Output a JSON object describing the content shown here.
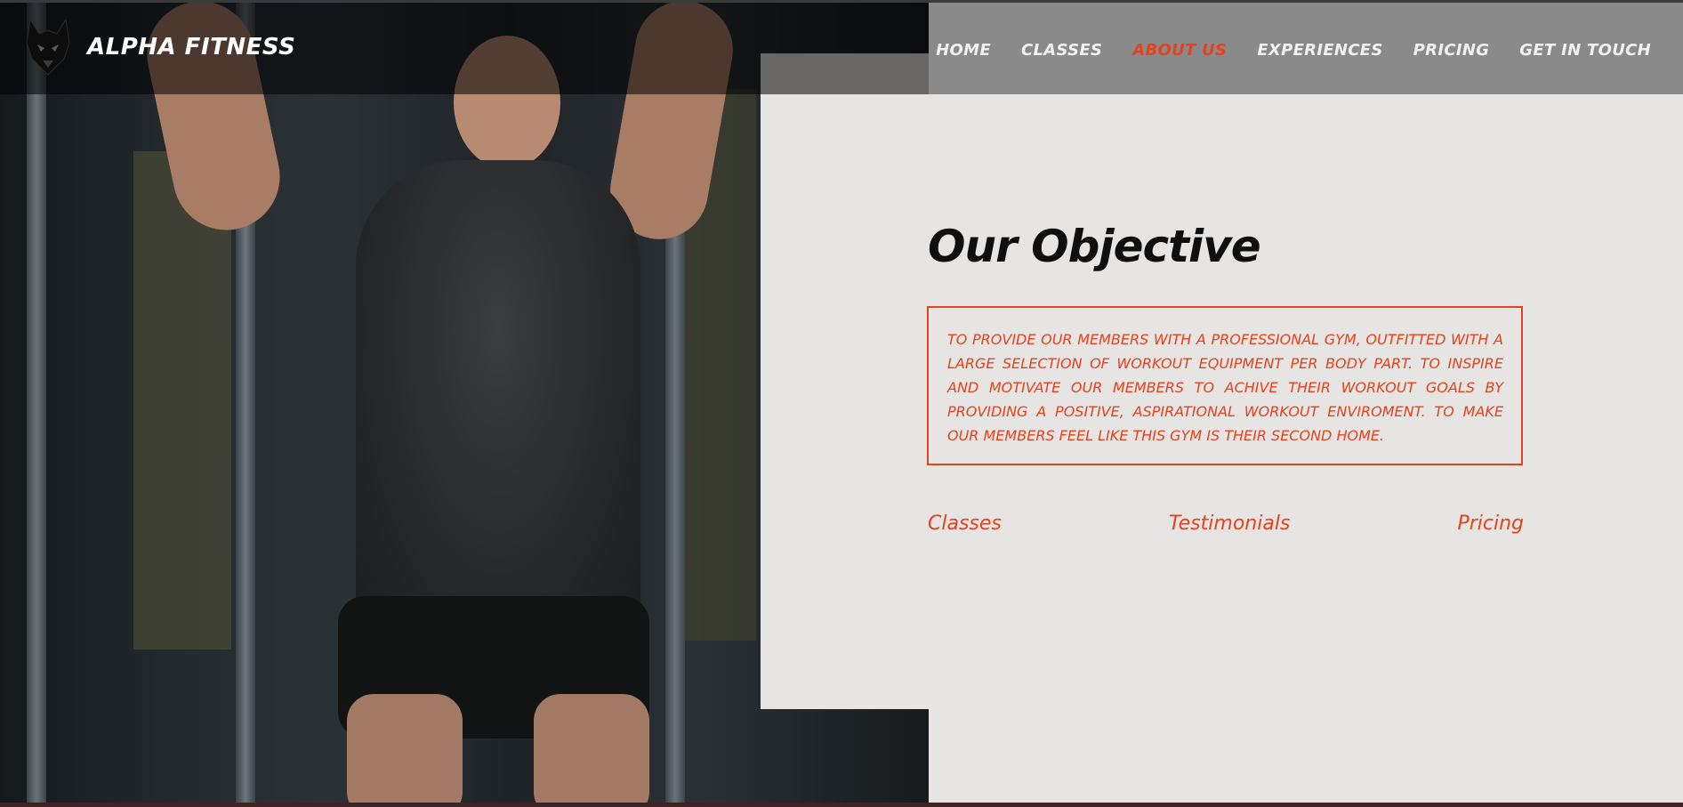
{
  "brand": {
    "name": "ALPHA FITNESS",
    "logo_icon": "wolf-icon"
  },
  "nav": {
    "items": [
      {
        "label": "HOME"
      },
      {
        "label": "CLASSES"
      },
      {
        "label": "ABOUT US",
        "active": true
      },
      {
        "label": "EXPERIENCES"
      },
      {
        "label": "PRICING"
      },
      {
        "label": "GET IN TOUCH"
      }
    ]
  },
  "objective": {
    "title": "Our Objective",
    "text": "TO PROVIDE OUR MEMBERS WITH A PROFESSIONAL GYM, OUTFITTED WITH A LARGE SELECTION OF WORKOUT EQUIPMENT PER BODY PART. TO INSPIRE AND MOTIVATE OUR MEMBERS TO ACHIVE THEIR WORKOUT GOALS BY PROVIDING A POSITIVE, ASPIRATIONAL WORKOUT ENVIROMENT. TO MAKE OUR MEMBERS FEEL LIKE THIS GYM IS THEIR SECOND HOME."
  },
  "links": {
    "classes": "Classes",
    "testimonials": "Testimonials",
    "pricing": "Pricing"
  },
  "colors": {
    "accent": "#e8411b",
    "panel": "#e6e5e3"
  }
}
